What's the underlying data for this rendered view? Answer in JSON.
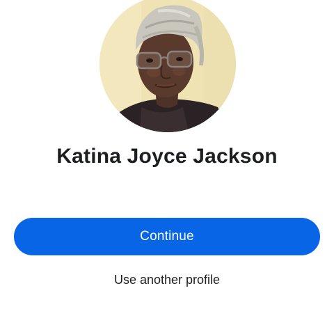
{
  "profile": {
    "name": "Katina Joyce Jackson",
    "photo": "profile-photo"
  },
  "actions": {
    "continue_label": "Continue",
    "other_profile_label": "Use another profile"
  },
  "colors": {
    "primary_button": "#0866e6",
    "button_text": "#ffffff",
    "name_text": "#1c1e21",
    "background": "#ffffff"
  }
}
